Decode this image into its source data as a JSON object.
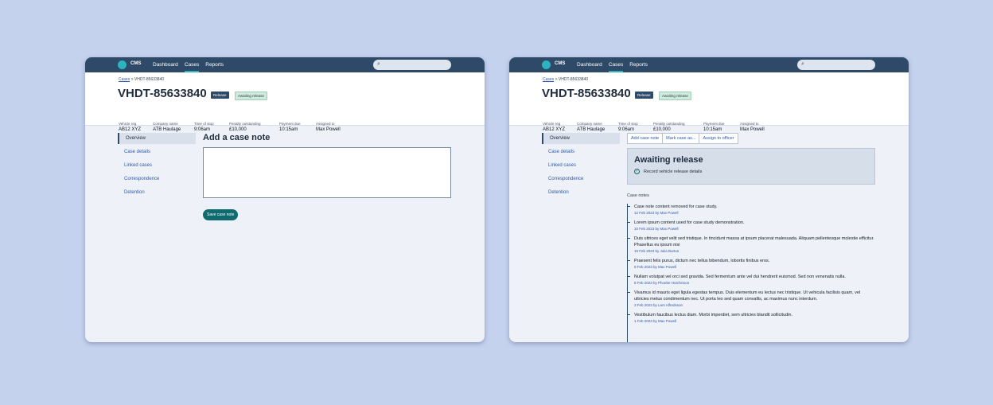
{
  "app": {
    "logo_text": "CMS",
    "nav": [
      "Dashboard",
      "Cases",
      "Reports"
    ],
    "search_placeholder": ""
  },
  "case": {
    "breadcrumb_root": "Cases",
    "breadcrumb_sep": ">",
    "breadcrumb_current": "VHDT-85633840",
    "id": "VHDT-85633840",
    "badge_type": "Release",
    "badge_status": "Awaiting release",
    "meta": [
      {
        "label": "Vehicle reg",
        "value": "AB12 XYZ"
      },
      {
        "label": "Company name",
        "value": "ATB Haulage"
      },
      {
        "label": "Time of stop",
        "value": "9:06am"
      },
      {
        "label": "Penalty outstanding",
        "value": "£10,000"
      },
      {
        "label": "Payment due",
        "value": "10:15am"
      },
      {
        "label": "Assigned to",
        "value": "Max Powell"
      }
    ]
  },
  "sidebar": {
    "items": [
      "Overview",
      "Case details",
      "Linked cases",
      "Correspondence",
      "Detention"
    ]
  },
  "note_form": {
    "heading": "Add a case note",
    "textarea_value": "",
    "save_label": "Save case note"
  },
  "overview": {
    "actions": [
      "Add case note",
      "Mark case as...",
      "Assign to officer"
    ],
    "status_title": "Awaiting release",
    "status_task": "Record vehicle release details",
    "notes_heading": "Case notes",
    "notes": [
      {
        "text": "Case note content removed for case study.",
        "meta": "12 Feb 2023 by Max Powell"
      },
      {
        "text": "Lorem ipsum content used for case study demonstration.",
        "meta": "10 Feb 2023 by Max Powell"
      },
      {
        "text": "Duis ultrices eget velit sed tristique. In tincidunt massa at ipsum placerat malesuada. Aliquam pellentesque molestie efficitur. Phasellus eu ipsum nisi",
        "meta": "10 Feb 2023 by Julia Burton"
      },
      {
        "text": "Praesent felis purus, dictum nec tellus bibendum, lobortis finibus eros.",
        "meta": "9 Feb 2023 by Max Powell"
      },
      {
        "text": "Nullam volutpat vel orci sed gravida. Sed fermentum ante vel dui hendrerit euismod. Sed non venenatis nulla.",
        "meta": "8 Feb 2023 by Phoebe Hutchinson"
      },
      {
        "text": "Vivamus id mauris eget ligula egestas tempus. Duis elementum eu lectus nec tristique. Ut vehicula facilisis quam, vel ultricies metus condimentum nec. Ut porta leo sed quam convallis, ac maximus nunc interdum.",
        "meta": "3 Feb 2023 by Lars Alfredsson"
      },
      {
        "text": "Vestibulum faucibus lectus diam. Morbi imperdiet, sem ultricies blandit sollicitudin.",
        "meta": "1 Feb 2023 by Max Powell"
      }
    ]
  }
}
